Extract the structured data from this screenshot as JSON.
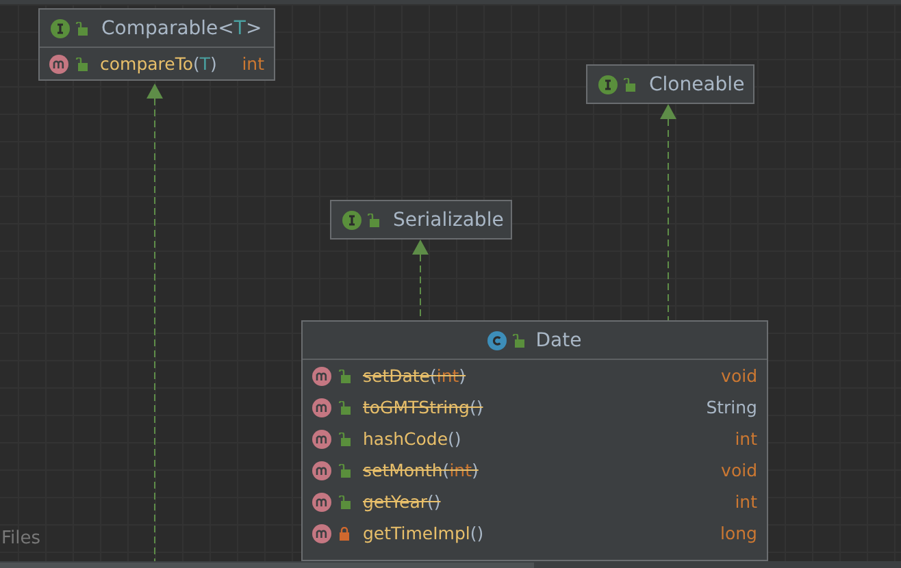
{
  "nodes": [
    {
      "kind": "interface",
      "name": "Comparable",
      "generic": "<T>",
      "private": false,
      "methods": [
        {
          "name": "compareTo",
          "params": "(T)",
          "param_generic": true,
          "return": "int",
          "return_primitive": true,
          "private": false,
          "deprecated": false
        }
      ]
    },
    {
      "kind": "interface",
      "name": "Cloneable",
      "private": false
    },
    {
      "kind": "interface",
      "name": "Serializable",
      "private": false
    },
    {
      "kind": "class",
      "name": "Date",
      "private": false,
      "methods": [
        {
          "name": "setDate",
          "params": "(int)",
          "param_generic": false,
          "return": "void",
          "return_primitive": true,
          "private": false,
          "deprecated": true
        },
        {
          "name": "toGMTString",
          "params": "()",
          "return": "String",
          "return_primitive": false,
          "private": false,
          "deprecated": true
        },
        {
          "name": "hashCode",
          "params": "()",
          "return": "int",
          "return_primitive": true,
          "private": false,
          "deprecated": false
        },
        {
          "name": "setMonth",
          "params": "(int)",
          "param_generic": false,
          "return": "void",
          "return_primitive": true,
          "private": false,
          "deprecated": true
        },
        {
          "name": "getYear",
          "params": "()",
          "return": "int",
          "return_primitive": true,
          "private": false,
          "deprecated": true
        },
        {
          "name": "getTimeImpl",
          "params": "()",
          "return": "long",
          "return_primitive": true,
          "private": true,
          "deprecated": false
        }
      ]
    }
  ],
  "side_panel": {
    "label": "Files"
  }
}
